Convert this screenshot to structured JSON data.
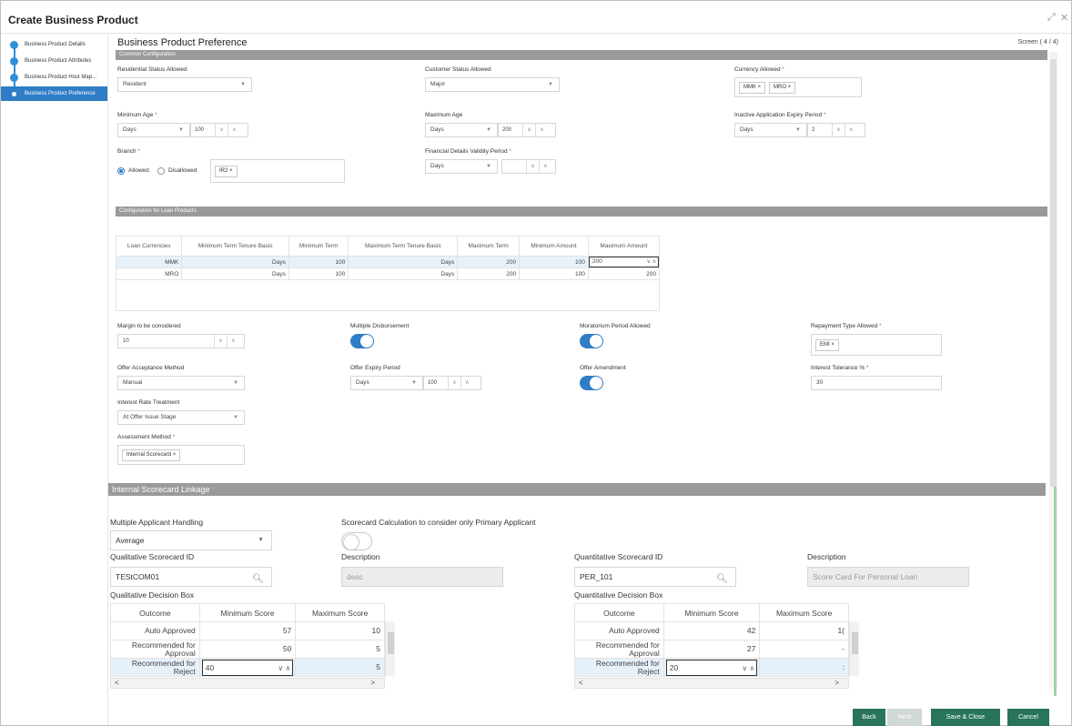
{
  "window": {
    "title": "Create Business Product",
    "resize_icon": "expand-icon",
    "close_icon": "close-icon"
  },
  "sidebar": {
    "items": [
      {
        "label": "Business Product Details",
        "active": false
      },
      {
        "label": "Business Product Attributes",
        "active": false
      },
      {
        "label": "Business Product Host Map...",
        "active": false
      },
      {
        "label": "Business Product Preference",
        "active": true
      }
    ]
  },
  "page": {
    "title": "Business Product Preference",
    "screen": "Screen ( 4 / 4)"
  },
  "common": {
    "section": "Common Configuration",
    "residential_status_label": "Residential Status Allowed",
    "residential_status_value": "Resident",
    "customer_status_label": "Customer Status Allowed",
    "customer_status_value": "Major",
    "currency_label": "Currency Allowed",
    "currency_chips": [
      "MMK ×",
      "MRO ×"
    ],
    "min_age_label": "Minimum Age",
    "min_age_unit": "Days",
    "min_age_value": "100",
    "max_age_label": "Maximum Age",
    "max_age_unit": "Days",
    "max_age_value": "200",
    "inactive_label": "Inactive Application Expiry Period",
    "inactive_unit": "Days",
    "inactive_value": "2",
    "branch_label": "Branch",
    "branch_allowed": "Allowed",
    "branch_disallowed": "Disallowed",
    "branch_chip": "IR2 ×",
    "fin_validity_label": "Financial Details Validity Period",
    "fin_validity_unit": "Days",
    "fin_validity_value": ""
  },
  "loan": {
    "section": "Configuration for Loan Products",
    "columns": [
      "Loan Currencies",
      "Minimum Term Tenure Basis",
      "Minimum Term",
      "Maximum Term Tenure Basis",
      "Maximum Term",
      "Minimum Amount",
      "Maximum Amount"
    ],
    "rows": [
      [
        "MMK",
        "Days",
        "100",
        "Days",
        "200",
        "100",
        "200"
      ],
      [
        "MRO",
        "Days",
        "100",
        "Days",
        "200",
        "100",
        "200"
      ]
    ]
  },
  "prefs": {
    "margin_label": "Margin to be considered",
    "margin_value": "10",
    "multi_disb_label": "Multiple Disbursement",
    "moratorium_label": "Moratorium Period Allowed",
    "repayment_label": "Repayment Type Allowed",
    "repayment_chip": "EMI ×",
    "offer_accept_label": "Offer Acceptance Method",
    "offer_accept_value": "Manual",
    "offer_expiry_label": "Offer Expiry Period",
    "offer_expiry_unit": "Days",
    "offer_expiry_value": "100",
    "offer_amend_label": "Offer Amendment",
    "interest_tol_label": "Interest Tolerance %",
    "interest_tol_value": "30",
    "rate_treatment_label": "Interest Rate Treatment",
    "rate_treatment_value": "At Offer Issue Stage",
    "assessment_label": "Assessment Method",
    "assessment_chip": "Internal Scorecard ×"
  },
  "scorecard": {
    "section": "Internal Scorecard Linkage",
    "multi_applicant_label": "Multiple Applicant Handling",
    "multi_applicant_value": "Average",
    "primary_only_label": "Scorecard Calculation to consider only Primary Applicant",
    "qual_id_label": "Qualitative Scorecard ID",
    "qual_id_value": "TEStCOM01",
    "qual_desc_label": "Description",
    "qual_desc_value": "desc",
    "quant_id_label": "Quantitative Scorecard ID",
    "quant_id_value": "PER_101",
    "quant_desc_label": "Description",
    "quant_desc_value": "Score Card For  Personal Loan",
    "qual_box_label": "Qualitative Decision Box",
    "quant_box_label": "Quantitative Decision Box",
    "columns": [
      "Outcome",
      "Minimum Score",
      "Maximum Score"
    ],
    "qual_rows": [
      [
        "Auto Approved",
        "57",
        "10"
      ],
      [
        "Recommended for Approval",
        "50",
        "5"
      ],
      [
        "Recommended for Reject",
        "40",
        "5"
      ]
    ],
    "quant_rows": [
      [
        "Auto Approved",
        "42",
        "1("
      ],
      [
        "Recommended for Approval",
        "27",
        "-"
      ],
      [
        "Recommended for Reject",
        "20",
        ":"
      ]
    ]
  },
  "footer": {
    "back": "Back",
    "next": "Next",
    "save_close": "Save & Close",
    "cancel": "Cancel"
  },
  "colors": {
    "accent": "#2f7dc7",
    "primary_button": "#28755c",
    "section_bar": "#9a9a9a"
  }
}
